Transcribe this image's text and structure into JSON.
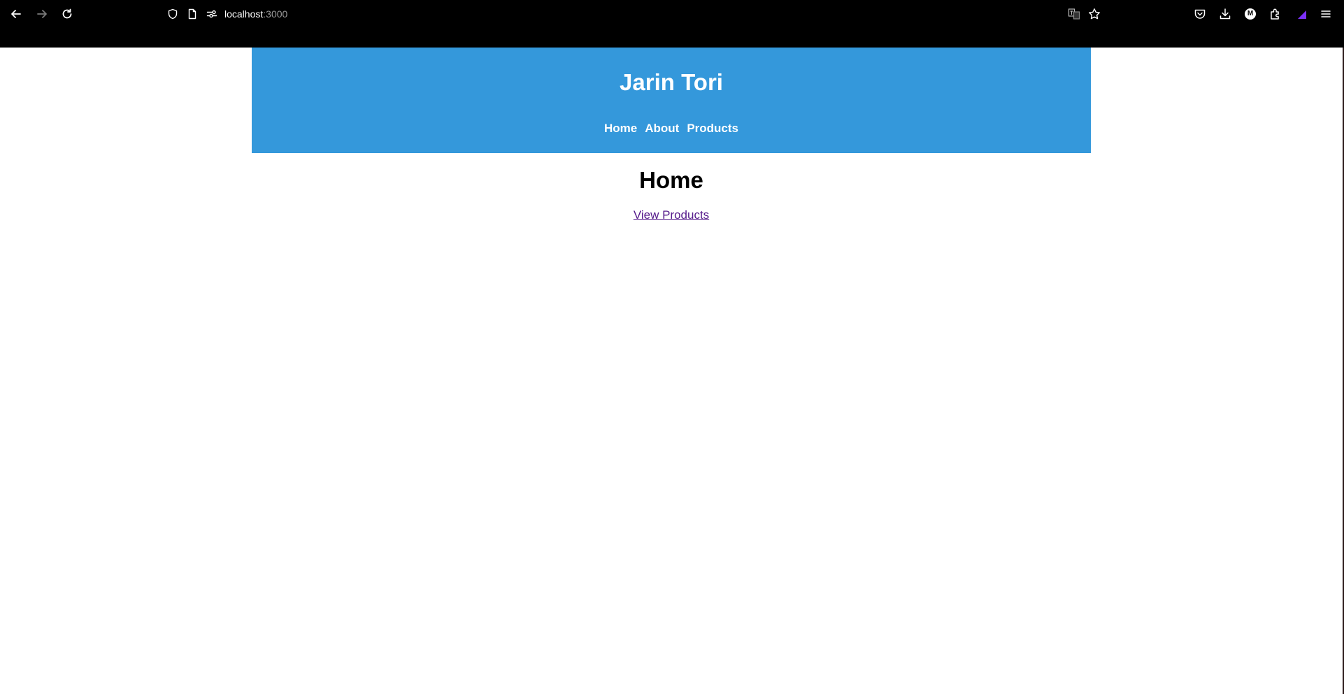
{
  "browser": {
    "url_host": "localhost",
    "url_port": ":3000",
    "icons": {
      "back": "back-arrow-icon",
      "forward": "forward-arrow-icon",
      "reload": "reload-icon",
      "shield": "tracking-shield-icon",
      "page": "page-info-icon",
      "permissions": "permissions-icon",
      "translate": "translate-icon",
      "bookmark": "bookmark-star-icon",
      "pocket": "pocket-icon",
      "downloads": "downloads-icon",
      "account": "account-icon",
      "extensions": "extensions-icon",
      "accent": "extension-accent-icon",
      "menu": "hamburger-menu-icon"
    },
    "account_initial": "M",
    "accent_color": "#7b2ff7"
  },
  "site": {
    "title": "Jarin Tori",
    "header_color": "#3498db",
    "nav": [
      {
        "label": "Home"
      },
      {
        "label": "About"
      },
      {
        "label": "Products"
      }
    ]
  },
  "main": {
    "heading": "Home",
    "link_label": "View Products",
    "link_color": "#551a8b"
  }
}
